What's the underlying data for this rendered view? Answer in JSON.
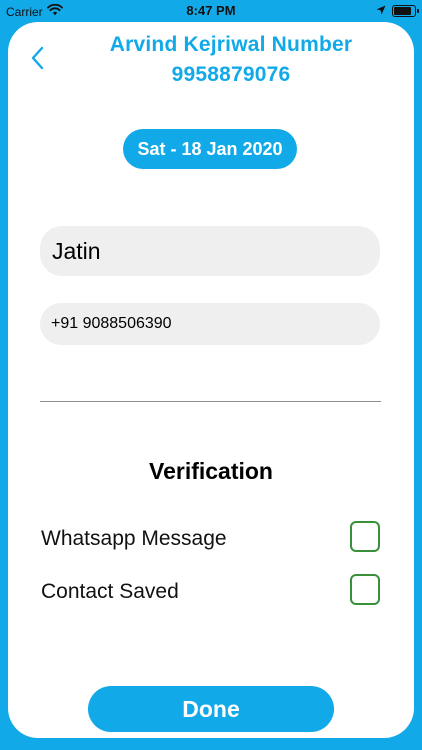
{
  "status_bar": {
    "carrier": "Carrier",
    "time": "8:47 PM",
    "icons": [
      "wifi-icon",
      "location-arrow-icon",
      "battery-icon"
    ]
  },
  "header": {
    "title_line1": "Arvind Kejriwal Number",
    "title_line2": "9958879076",
    "back_icon": "chevron-left-icon"
  },
  "date_label": "Sat - 18 Jan 2020",
  "form": {
    "name_value": "Jatin",
    "phone_value": "+91 9088506390"
  },
  "verification": {
    "title": "Verification",
    "items": [
      {
        "label": "Whatsapp Message",
        "checked": false
      },
      {
        "label": "Contact Saved",
        "checked": false
      }
    ]
  },
  "done_label": "Done",
  "colors": {
    "accent": "#12a9e8",
    "checkbox_border": "#3a8f3a",
    "input_bg": "#efefef"
  }
}
